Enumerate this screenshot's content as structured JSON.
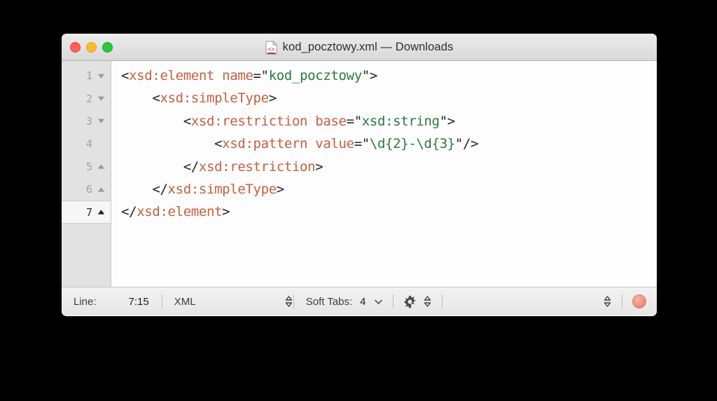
{
  "window": {
    "title": "kod_pocztowy.xml — Downloads",
    "file_icon": "xml-document-icon",
    "traffic_lights": [
      {
        "name": "close-button",
        "label": "Close",
        "color": "#ff5f57"
      },
      {
        "name": "minimize-button",
        "label": "Minimize",
        "color": "#febc2e"
      },
      {
        "name": "maximize-button",
        "label": "Maximize",
        "color": "#28c840"
      }
    ]
  },
  "editor": {
    "active_line": 7,
    "lines": [
      {
        "number": "1",
        "fold": "collapse-arrow-down",
        "text": "<xsd:element name=\"kod_pocztowy\">",
        "tokens": [
          {
            "t": "punct",
            "s": "<"
          },
          {
            "t": "tag",
            "s": "xsd:element"
          },
          {
            "t": "punct",
            "s": " "
          },
          {
            "t": "attr",
            "s": "name"
          },
          {
            "t": "eq",
            "s": "="
          },
          {
            "t": "quote",
            "s": "\""
          },
          {
            "t": "val",
            "s": "kod_pocztowy"
          },
          {
            "t": "quote",
            "s": "\""
          },
          {
            "t": "punct",
            "s": ">"
          }
        ]
      },
      {
        "number": "2",
        "fold": "collapse-arrow-down",
        "text": "    <xsd:simpleType>",
        "tokens": [
          {
            "t": "punct",
            "s": "    <"
          },
          {
            "t": "tag",
            "s": "xsd:simpleType"
          },
          {
            "t": "punct",
            "s": ">"
          }
        ]
      },
      {
        "number": "3",
        "fold": "collapse-arrow-down",
        "text": "        <xsd:restriction base=\"xsd:string\">",
        "tokens": [
          {
            "t": "punct",
            "s": "        <"
          },
          {
            "t": "tag",
            "s": "xsd:restriction"
          },
          {
            "t": "punct",
            "s": " "
          },
          {
            "t": "attr",
            "s": "base"
          },
          {
            "t": "eq",
            "s": "="
          },
          {
            "t": "quote",
            "s": "\""
          },
          {
            "t": "val",
            "s": "xsd:string"
          },
          {
            "t": "quote",
            "s": "\""
          },
          {
            "t": "punct",
            "s": ">"
          }
        ]
      },
      {
        "number": "4",
        "fold": "none",
        "text": "            <xsd:pattern value=\"\\d{2}-\\d{3}\"/>",
        "tokens": [
          {
            "t": "punct",
            "s": "            <"
          },
          {
            "t": "tag",
            "s": "xsd:pattern"
          },
          {
            "t": "punct",
            "s": " "
          },
          {
            "t": "attr",
            "s": "value"
          },
          {
            "t": "eq",
            "s": "="
          },
          {
            "t": "quote",
            "s": "\""
          },
          {
            "t": "val",
            "s": "\\d{2}-\\d{3}"
          },
          {
            "t": "quote",
            "s": "\""
          },
          {
            "t": "punct",
            "s": "/>"
          }
        ]
      },
      {
        "number": "5",
        "fold": "expand-arrow-up",
        "text": "        </xsd:restriction>",
        "tokens": [
          {
            "t": "punct",
            "s": "        </"
          },
          {
            "t": "tag",
            "s": "xsd:restriction"
          },
          {
            "t": "punct",
            "s": ">"
          }
        ]
      },
      {
        "number": "6",
        "fold": "expand-arrow-up",
        "text": "    </xsd:simpleType>",
        "tokens": [
          {
            "t": "punct",
            "s": "    </"
          },
          {
            "t": "tag",
            "s": "xsd:simpleType"
          },
          {
            "t": "punct",
            "s": ">"
          }
        ]
      },
      {
        "number": "7",
        "fold": "expand-arrow-up",
        "text": "</xsd:element>",
        "tokens": [
          {
            "t": "punct",
            "s": "</"
          },
          {
            "t": "tag",
            "s": "xsd:element"
          },
          {
            "t": "punct",
            "s": ">"
          }
        ]
      }
    ]
  },
  "statusbar": {
    "line_label": "Line:",
    "line_value": "7:15",
    "syntax_mode": "XML",
    "soft_tabs_label": "Soft Tabs:",
    "soft_tabs_value": "4",
    "gear_icon": "gear-icon",
    "save_indicator": "unsaved-changes-dot"
  },
  "colors": {
    "tag": "#c4603f",
    "attribute_value": "#28793f",
    "punctuation": "#232323",
    "editor_background": "#fdfdfd",
    "gutter_background": "#e2e2e2",
    "save_dot": "#ef9284"
  }
}
